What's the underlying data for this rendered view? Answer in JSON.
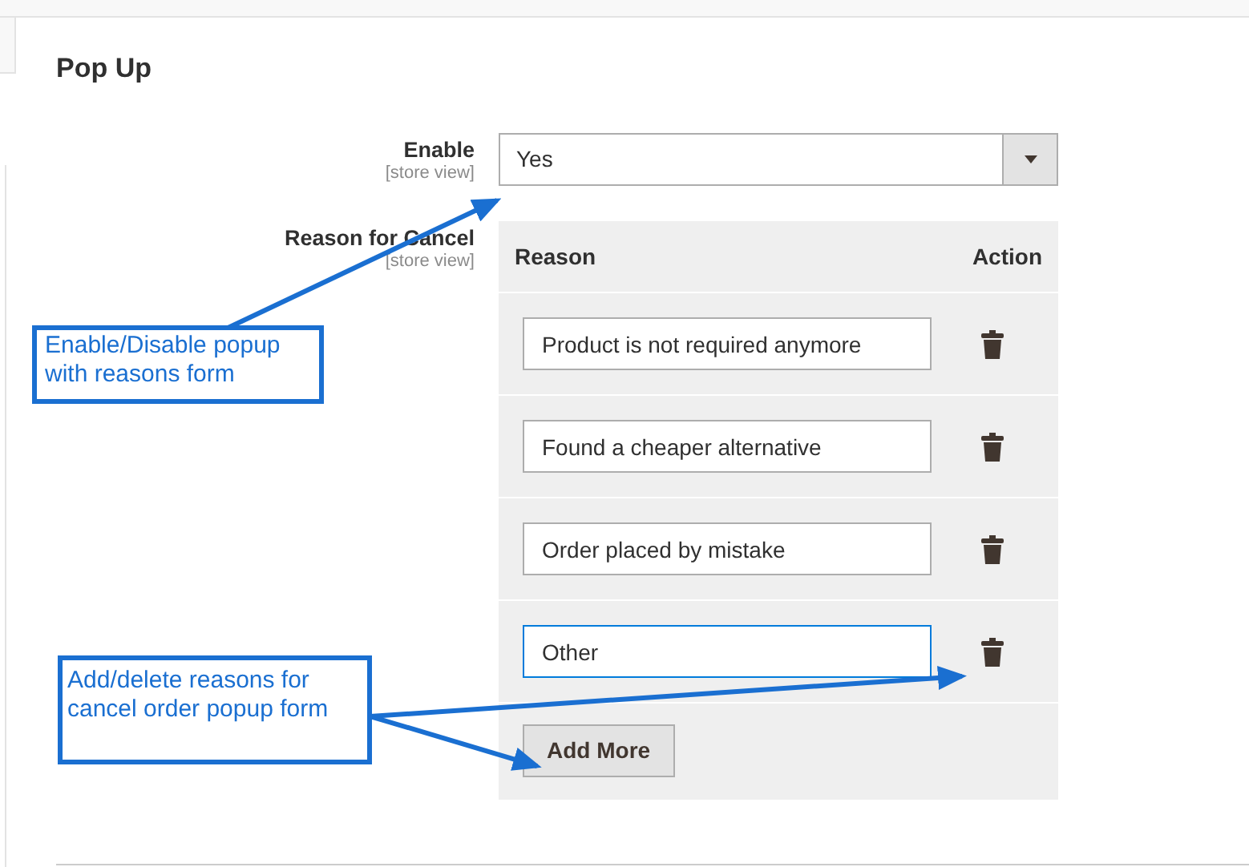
{
  "section": {
    "title": "Pop Up"
  },
  "enable": {
    "label": "Enable",
    "scope": "[store view]",
    "value": "Yes"
  },
  "reasons": {
    "label": "Reason for Cancel",
    "scope": "[store view]",
    "columns": [
      "Reason",
      "Action"
    ],
    "rows": [
      {
        "value": "Product is not required anymore",
        "focused": false
      },
      {
        "value": "Found a cheaper alternative",
        "focused": false
      },
      {
        "value": "Order placed by mistake",
        "focused": false
      },
      {
        "value": "Other",
        "focused": true
      }
    ],
    "add_button": "Add More"
  },
  "annotations": [
    {
      "text": "Enable/Disable popup with reasons form"
    },
    {
      "text": "Add/delete reasons for cancel order popup form"
    }
  ]
}
